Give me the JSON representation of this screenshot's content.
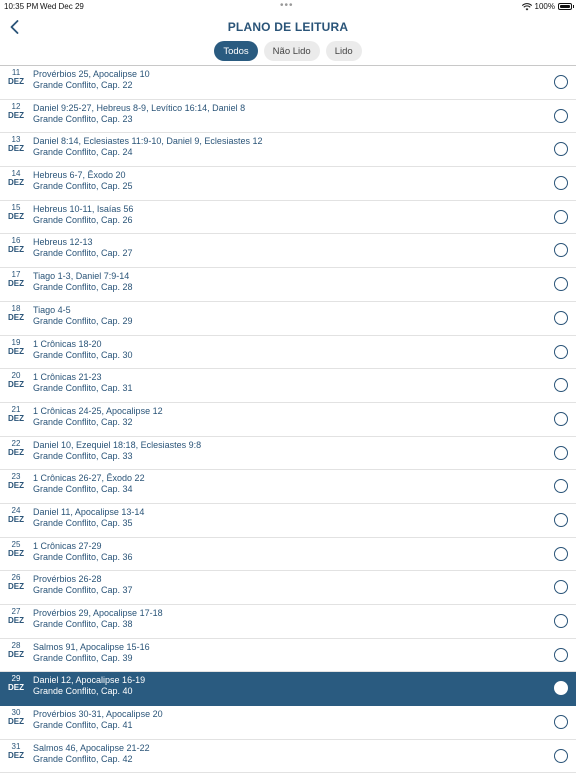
{
  "status_bar": {
    "time": "10:35 PM",
    "date": "Wed Dec 29",
    "dots": "•••",
    "battery": "100%"
  },
  "header": {
    "title": "PLANO DE LEITURA",
    "back_icon": "chevron-left-icon"
  },
  "filters": [
    {
      "label": "Todos",
      "active": true
    },
    {
      "label": "Não Lido",
      "active": false
    },
    {
      "label": "Lido",
      "active": false
    }
  ],
  "colors": {
    "accent": "#2a5b80",
    "text": "#2a5478",
    "segment_bg": "#ebebeb"
  },
  "readings": [
    {
      "day": "11",
      "month": "DEZ",
      "reading": "Provérbios 25, Apocalipse 10",
      "book": "Grande Conflito, Cap. 22",
      "selected": false
    },
    {
      "day": "12",
      "month": "DEZ",
      "reading": "Daniel 9:25-27, Hebreus 8-9, Levítico 16:14, Daniel 8",
      "book": "Grande Conflito, Cap. 23",
      "selected": false
    },
    {
      "day": "13",
      "month": "DEZ",
      "reading": "Daniel 8:14, Eclesiastes 11:9-10, Daniel 9, Eclesiastes 12",
      "book": "Grande Conflito, Cap. 24",
      "selected": false
    },
    {
      "day": "14",
      "month": "DEZ",
      "reading": "Hebreus 6-7, Êxodo 20",
      "book": "Grande Conflito, Cap. 25",
      "selected": false
    },
    {
      "day": "15",
      "month": "DEZ",
      "reading": "Hebreus 10-11, Isaías 56",
      "book": "Grande Conflito, Cap. 26",
      "selected": false
    },
    {
      "day": "16",
      "month": "DEZ",
      "reading": "Hebreus 12-13",
      "book": "Grande Conflito, Cap. 27",
      "selected": false
    },
    {
      "day": "17",
      "month": "DEZ",
      "reading": "Tiago 1-3, Daniel 7:9-14",
      "book": "Grande Conflito, Cap. 28",
      "selected": false
    },
    {
      "day": "18",
      "month": "DEZ",
      "reading": "Tiago 4-5",
      "book": "Grande Conflito, Cap. 29",
      "selected": false
    },
    {
      "day": "19",
      "month": "DEZ",
      "reading": "1 Crônicas 18-20",
      "book": "Grande Conflito, Cap. 30",
      "selected": false
    },
    {
      "day": "20",
      "month": "DEZ",
      "reading": "1 Crônicas 21-23",
      "book": "Grande Conflito, Cap. 31",
      "selected": false
    },
    {
      "day": "21",
      "month": "DEZ",
      "reading": "1 Crônicas 24-25, Apocalipse 12",
      "book": "Grande Conflito, Cap. 32",
      "selected": false
    },
    {
      "day": "22",
      "month": "DEZ",
      "reading": "Daniel 10, Ezequiel 18:18, Eclesiastes 9:8",
      "book": "Grande Conflito, Cap. 33",
      "selected": false
    },
    {
      "day": "23",
      "month": "DEZ",
      "reading": "1 Crônicas 26-27, Êxodo 22",
      "book": "Grande Conflito, Cap. 34",
      "selected": false
    },
    {
      "day": "24",
      "month": "DEZ",
      "reading": "Daniel 11, Apocalipse 13-14",
      "book": "Grande Conflito, Cap. 35",
      "selected": false
    },
    {
      "day": "25",
      "month": "DEZ",
      "reading": "1 Crônicas 27-29",
      "book": "Grande Conflito, Cap. 36",
      "selected": false
    },
    {
      "day": "26",
      "month": "DEZ",
      "reading": "Provérbios 26-28",
      "book": "Grande Conflito, Cap. 37",
      "selected": false
    },
    {
      "day": "27",
      "month": "DEZ",
      "reading": "Provérbios 29, Apocalipse 17-18",
      "book": "Grande Conflito, Cap. 38",
      "selected": false
    },
    {
      "day": "28",
      "month": "DEZ",
      "reading": "Salmos 91, Apocalipse 15-16",
      "book": "Grande Conflito, Cap. 39",
      "selected": false
    },
    {
      "day": "29",
      "month": "DEZ",
      "reading": "Daniel 12, Apocalipse 16-19",
      "book": "Grande Conflito, Cap. 40",
      "selected": true
    },
    {
      "day": "30",
      "month": "DEZ",
      "reading": "Provérbios 30-31, Apocalipse 20",
      "book": "Grande Conflito, Cap. 41",
      "selected": false
    },
    {
      "day": "31",
      "month": "DEZ",
      "reading": "Salmos 46, Apocalipse 21-22",
      "book": "Grande Conflito, Cap. 42",
      "selected": false
    }
  ]
}
